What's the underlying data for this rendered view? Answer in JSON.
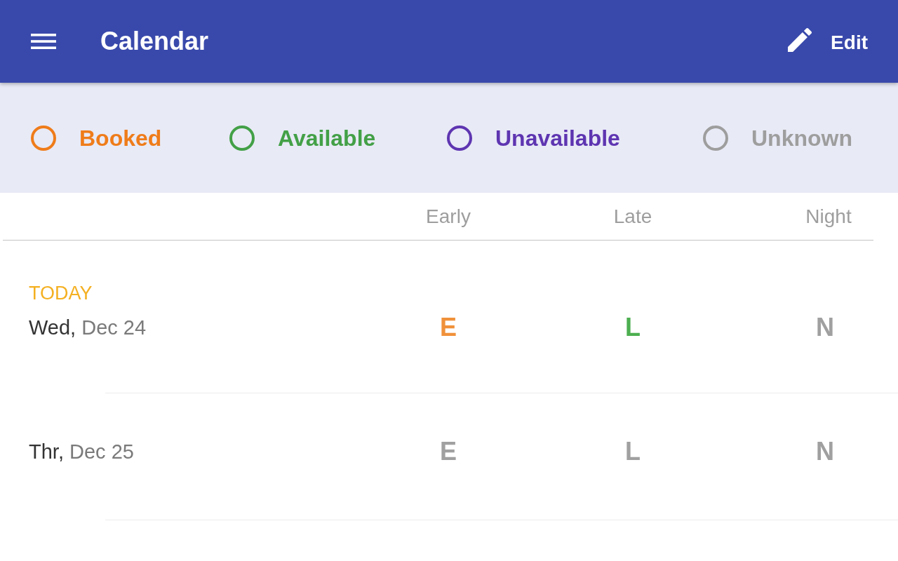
{
  "app_bar": {
    "title": "Calendar",
    "action": {
      "label": "Edit"
    }
  },
  "legend": [
    {
      "label": "Booked",
      "color": "#ef7c1a"
    },
    {
      "label": "Available",
      "color": "#43a047"
    },
    {
      "label": "Unavailable",
      "color": "#5e35b1"
    },
    {
      "label": "Unknown",
      "color": "#9e9e9e"
    }
  ],
  "schedule": {
    "columns": [
      "Early",
      "Late",
      "Night"
    ],
    "days": [
      {
        "today_label": "TODAY",
        "weekday": "Wed,",
        "date": "Dec 24",
        "shifts": [
          {
            "letter": "E",
            "color": "#f0913a"
          },
          {
            "letter": "L",
            "color": "#4caf50"
          },
          {
            "letter": "N",
            "color": "#a0a0a0"
          }
        ]
      },
      {
        "weekday": "Thr,",
        "date": "Dec 25",
        "shifts": [
          {
            "letter": "E",
            "color": "#a0a0a0"
          },
          {
            "letter": "L",
            "color": "#a0a0a0"
          },
          {
            "letter": "N",
            "color": "#a0a0a0"
          }
        ]
      }
    ]
  }
}
